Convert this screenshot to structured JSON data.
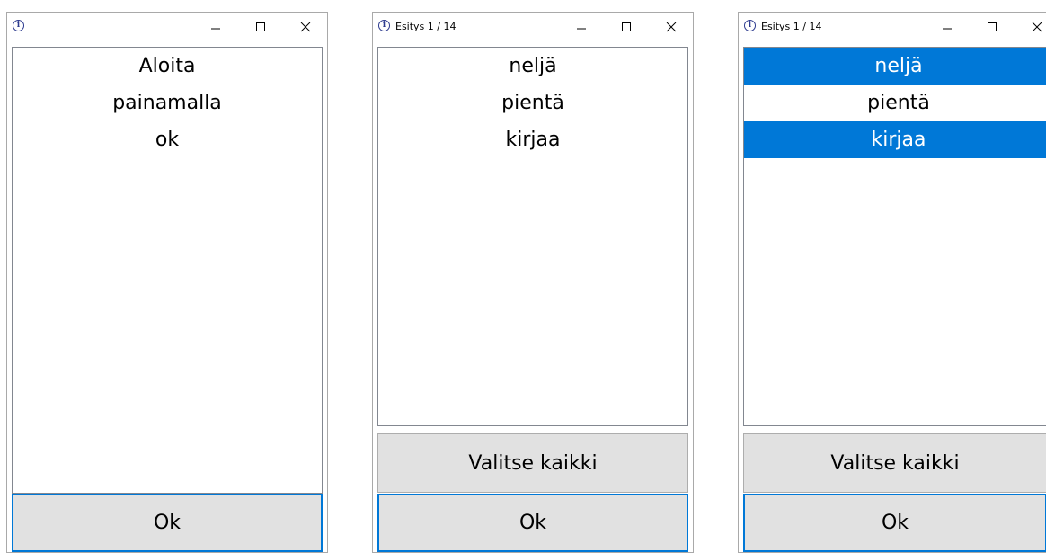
{
  "windows": [
    {
      "title": "",
      "list_items": [
        {
          "text": "Aloita",
          "selected": false
        },
        {
          "text": "painamalla",
          "selected": false
        },
        {
          "text": "ok",
          "selected": false
        }
      ],
      "ok_label": "Ok"
    },
    {
      "title": "Esitys 1 / 14",
      "list_items": [
        {
          "text": "neljä",
          "selected": false
        },
        {
          "text": "pientä",
          "selected": false
        },
        {
          "text": "kirjaa",
          "selected": false
        }
      ],
      "select_all_label": "Valitse kaikki",
      "ok_label": "Ok"
    },
    {
      "title": "Esitys 1 / 14",
      "list_items": [
        {
          "text": "neljä",
          "selected": true
        },
        {
          "text": "pientä",
          "selected": false
        },
        {
          "text": "kirjaa",
          "selected": true
        }
      ],
      "select_all_label": "Valitse kaikki",
      "ok_label": "Ok"
    }
  ],
  "colors": {
    "selection": "#0078d7",
    "button_bg": "#e1e1e1",
    "focus_border": "#0078d7"
  },
  "icons": {
    "app": "info-icon",
    "minimize": "minimize-icon",
    "maximize": "maximize-icon",
    "close": "close-icon"
  }
}
